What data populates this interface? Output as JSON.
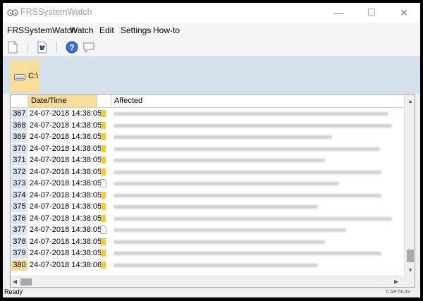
{
  "window": {
    "title": "FRSSystemWatch",
    "minimize_glyph": "—",
    "maximize_glyph": "☐",
    "close_glyph": "✕"
  },
  "menu": {
    "items": [
      {
        "label": "FRSSystemWatch"
      },
      {
        "label": "Watch"
      },
      {
        "label": "Edit"
      },
      {
        "label": "Settings"
      },
      {
        "label": "How-to"
      }
    ]
  },
  "toolbar": {
    "icons": [
      "new-document-icon",
      "open-file-icon",
      "help-icon",
      "comment-icon"
    ]
  },
  "drives": {
    "items": [
      {
        "label": "C:\\",
        "icon": "drive-icon",
        "selected": true
      }
    ]
  },
  "list": {
    "columns": [
      "",
      "Date/Time",
      "",
      "Affected"
    ],
    "rows": [
      {
        "num": "367",
        "datetime": "24-07-2018 14:38:05",
        "icon": "folder",
        "bar": 390
      },
      {
        "num": "368",
        "datetime": "24-07-2018 14:38:05",
        "icon": "folder",
        "bar": 395
      },
      {
        "num": "369",
        "datetime": "24-07-2018 14:38:05",
        "icon": "folder",
        "bar": 310
      },
      {
        "num": "370",
        "datetime": "24-07-2018 14:38:05",
        "icon": "folder",
        "bar": 378
      },
      {
        "num": "371",
        "datetime": "24-07-2018 14:38:05",
        "icon": "folder",
        "bar": 300
      },
      {
        "num": "372",
        "datetime": "24-07-2018 14:38:05",
        "icon": "folder",
        "bar": 380
      },
      {
        "num": "373",
        "datetime": "24-07-2018 14:38:05",
        "icon": "file",
        "bar": 320
      },
      {
        "num": "374",
        "datetime": "24-07-2018 14:38:05",
        "icon": "folder",
        "bar": 380
      },
      {
        "num": "375",
        "datetime": "24-07-2018 14:38:05",
        "icon": "folder",
        "bar": 290
      },
      {
        "num": "376",
        "datetime": "24-07-2018 14:38:05",
        "icon": "folder",
        "bar": 395
      },
      {
        "num": "377",
        "datetime": "24-07-2018 14:38:05",
        "icon": "file",
        "bar": 330
      },
      {
        "num": "378",
        "datetime": "24-07-2018 14:38:05",
        "icon": "folder",
        "bar": 300
      },
      {
        "num": "379",
        "datetime": "24-07-2018 14:38:05",
        "icon": "folder",
        "bar": 380
      },
      {
        "num": "380",
        "datetime": "24-07-2018 14:38:06",
        "icon": "folder",
        "bar": 290,
        "selected": true
      }
    ]
  },
  "status": {
    "left": "Ready",
    "right": "CAP NUM"
  },
  "colors": {
    "accent_selected": "#f7dc9a",
    "drive_bar_bg": "#d4e1ed",
    "row_number_bg": "#dce6f1",
    "folder_yellow": "#f5c842"
  }
}
